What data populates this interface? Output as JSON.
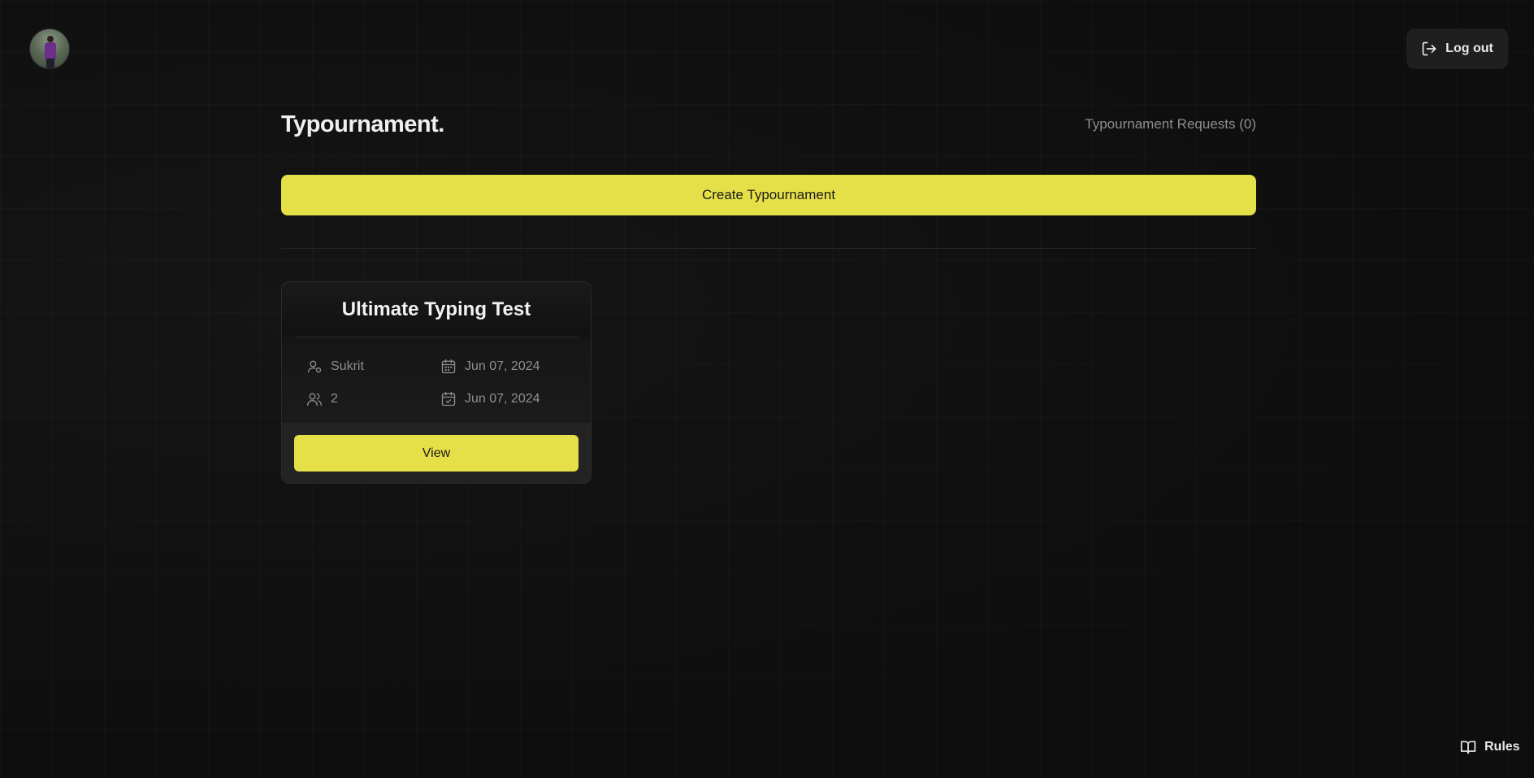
{
  "header": {
    "logout_label": "Log out"
  },
  "main": {
    "title": "Typournament.",
    "requests_link": "Typournament Requests (0)",
    "create_button": "Create Typournament"
  },
  "tournaments": [
    {
      "title": "Ultimate Typing Test",
      "creator": "Sukrit",
      "participants": "2",
      "start_date": "Jun 07, 2024",
      "end_date": "Jun 07, 2024",
      "view_label": "View"
    }
  ],
  "footer": {
    "rules_label": "Rules"
  },
  "colors": {
    "accent": "#e6e048",
    "background": "#101010"
  },
  "icons": {
    "logout": "logout-icon",
    "creator": "user-icon",
    "participants": "users-icon",
    "start_date": "calendar-icon",
    "end_date": "calendar-check-icon",
    "rules": "book-icon"
  }
}
